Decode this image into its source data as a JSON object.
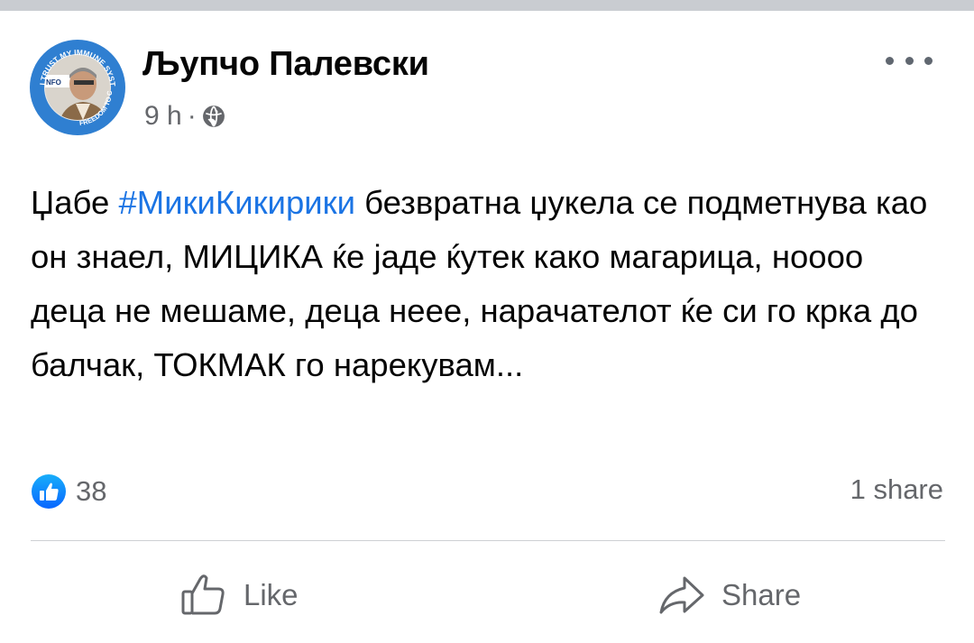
{
  "post": {
    "author": "Љупчо Палевски",
    "time": "9 h",
    "meta_separator": "·",
    "visibility_icon": "globe-icon",
    "avatar": {
      "ring_text_top": "I TRUST MY IMMUNE SYSTEM",
      "ring_text_bottom": "FREEDOM TO CHOOSE",
      "badge_text": "NFO",
      "ring_color": "#2f7fd1"
    },
    "text_before": "Џабе ",
    "hashtag": "#МикиКикирики",
    "text_after": " безвратна џукела се подметнува као он знаел, МИЦИКА ќе јаде ќутек како магарица, нoooо деца не мешаме, деца нееe, нарачателот ќе си го крка до балчак, ТОКМАК го нарекувам...",
    "reaction_icon": "like-icon",
    "reactions_count": "38",
    "shares": "1 share"
  },
  "actions": {
    "like": {
      "label": "Like",
      "icon": "thumbs-up-icon"
    },
    "share": {
      "label": "Share",
      "icon": "share-arrow-icon"
    }
  },
  "colors": {
    "hashtag": "#1b74e4",
    "meta": "#65676b",
    "like_badge": "#1877f2"
  }
}
